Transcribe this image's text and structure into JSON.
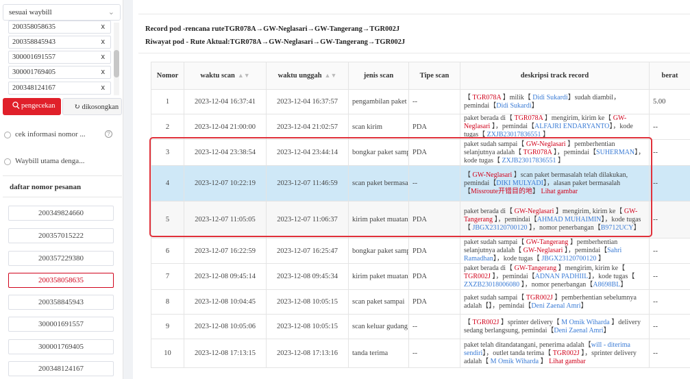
{
  "left": {
    "select_value": "sesuai waybill",
    "waybills": [
      "200358058635",
      "200358845943",
      "300001691557",
      "300001769405",
      "200348124167"
    ],
    "remove_glyph": "x",
    "search_label": "pengecekan",
    "clear_label": "dikosongkan",
    "options": [
      "cek informasi nomor ...",
      "Waybill utama denga..."
    ],
    "help_glyph": "?",
    "orders_title": "daftar nomor pesanan",
    "orders": [
      "200349824660",
      "200357015222",
      "200357229380",
      "200358058635",
      "200358845943",
      "300001691557",
      "300001769405",
      "200348124167"
    ],
    "active_order": "200358058635"
  },
  "route": {
    "plan": "Record pod -rencana ruteTGR078A→GW-Neglasari→GW-Tangerang→TGR002J",
    "actual": "Riwayat pod - Rute Aktual:TGR078A→GW-Neglasari→GW-Tangerang→TGR002J"
  },
  "table": {
    "headers": [
      "Nomor",
      "waktu scan",
      "waktu unggah",
      "jenis scan",
      "Tipe scan",
      "deskripsi track record",
      "berat"
    ],
    "rows": [
      {
        "no": "1",
        "scan": "2023-12-04 16:37:41",
        "upload": "2023-12-04 16:37:57",
        "type": "pengambilan paket",
        "tipe": "--",
        "weight": "5.00",
        "desc": [
          [
            "【",
            ""
          ],
          [
            " TGR078A ",
            "red"
          ],
          [
            "】milik【 ",
            ""
          ],
          [
            "Didi Sukardi",
            "blue"
          ],
          [
            "】sudah diambil，pemindai【",
            ""
          ],
          [
            "Didi Sukardi",
            "blue"
          ],
          [
            "】",
            ""
          ]
        ]
      },
      {
        "no": "2",
        "scan": "2023-12-04 21:00:00",
        "upload": "2023-12-04 21:02:57",
        "type": "scan kirim",
        "tipe": "PDA",
        "weight": "--",
        "desc": [
          [
            "paket berada di【 ",
            ""
          ],
          [
            "TGR078A",
            "red"
          ],
          [
            " 】mengirim, kirim ke【 ",
            ""
          ],
          [
            "GW-Neglasari",
            "red"
          ],
          [
            " 】，pemindai【",
            ""
          ],
          [
            "ALFAJRI ENDARYANTO",
            "blue"
          ],
          [
            "】，kode tugas【 ",
            ""
          ],
          [
            "ZXJB23017836551",
            "blue"
          ],
          [
            " 】",
            ""
          ]
        ]
      },
      {
        "no": "3",
        "scan": "2023-12-04 23:38:54",
        "upload": "2023-12-04 23:44:14",
        "type": "bongkar paket sampai",
        "tipe": "PDA",
        "weight": "--",
        "desc": [
          [
            "paket sudah sampai【 ",
            ""
          ],
          [
            "GW-Neglasari",
            "red"
          ],
          [
            " 】pemberhentian selanjutnya adalah【 ",
            ""
          ],
          [
            "TGR078A",
            "red"
          ],
          [
            " 】，pemindai【",
            ""
          ],
          [
            "SUHERMAN",
            "blue"
          ],
          [
            "】，kode tugas【 ",
            ""
          ],
          [
            "ZXJB23017836551",
            "blue"
          ],
          [
            " 】",
            ""
          ]
        ]
      },
      {
        "no": "4",
        "scan": "2023-12-07 10:22:19",
        "upload": "2023-12-07 11:46:59",
        "type": "scan paket bermasalah",
        "tipe": "--",
        "weight": "--",
        "desc": [
          [
            "【 ",
            ""
          ],
          [
            "GW-Neglasari",
            "red"
          ],
          [
            " 】scan paket bermasalah telah dilakukan, pemindai【",
            ""
          ],
          [
            "DIKI MULYADI",
            "blue"
          ],
          [
            "】，alasan paket bermasalah【",
            ""
          ],
          [
            "Missroute开错目的地",
            "red"
          ],
          [
            "】  ",
            ""
          ],
          [
            "Lihat gambar",
            "red"
          ]
        ]
      },
      {
        "no": "5",
        "scan": "2023-12-07 11:05:05",
        "upload": "2023-12-07 11:06:37",
        "type": "kirim paket muatan",
        "tipe": "PDA",
        "weight": "--",
        "desc": [
          [
            "paket berada di【 ",
            ""
          ],
          [
            "GW-Neglasari",
            "red"
          ],
          [
            " 】mengirim, kirim ke【 ",
            ""
          ],
          [
            "GW-Tangerang",
            "red"
          ],
          [
            " 】，pemindai【",
            ""
          ],
          [
            "AHMAD MUHAIMIN",
            "blue"
          ],
          [
            "】，kode tugas【 ",
            ""
          ],
          [
            "JBGX23120700120",
            "blue"
          ],
          [
            " 】，nomor penerbangan【",
            ""
          ],
          [
            "B9712UCY",
            "blue"
          ],
          [
            "】",
            ""
          ]
        ]
      },
      {
        "no": "6",
        "scan": "2023-12-07 16:22:59",
        "upload": "2023-12-07 16:25:47",
        "type": "bongkar paket sampai",
        "tipe": "PDA",
        "weight": "--",
        "desc": [
          [
            "paket sudah sampai【 ",
            ""
          ],
          [
            "GW-Tangerang",
            "red"
          ],
          [
            " 】pemberhentian selanjutnya adalah【 ",
            ""
          ],
          [
            "GW-Neglasari",
            "red"
          ],
          [
            " 】，pemindai【",
            ""
          ],
          [
            "Sahri Ramadhan",
            "blue"
          ],
          [
            "】，kode tugas【 ",
            ""
          ],
          [
            "JBGX23120700120",
            "blue"
          ],
          [
            " 】",
            ""
          ]
        ]
      },
      {
        "no": "7",
        "scan": "2023-12-08 09:45:14",
        "upload": "2023-12-08 09:45:34",
        "type": "kirim paket muatan",
        "tipe": "PDA",
        "weight": "--",
        "desc": [
          [
            "paket berada di【 ",
            ""
          ],
          [
            "GW-Tangerang",
            "red"
          ],
          [
            " 】mengirim, kirim ke【 ",
            ""
          ],
          [
            "TGR002J",
            "red"
          ],
          [
            " 】，pemindai【",
            ""
          ],
          [
            "ADNAN PADHIIL",
            "blue"
          ],
          [
            "】，kode tugas【 ",
            ""
          ],
          [
            "ZXZB23018006080",
            "blue"
          ],
          [
            " 】，nomor penerbangan【",
            ""
          ],
          [
            "A8698BL",
            "blue"
          ],
          [
            "】",
            ""
          ]
        ]
      },
      {
        "no": "8",
        "scan": "2023-12-08 10:04:45",
        "upload": "2023-12-08 10:05:15",
        "type": "scan paket sampai",
        "tipe": "PDA",
        "weight": "--",
        "desc": [
          [
            "paket sudah sampai【 ",
            ""
          ],
          [
            "TGR002J",
            "red"
          ],
          [
            " 】pemberhentian sebelumnya adalah【",
            ""
          ],
          [
            "",
            ""
          ],
          [
            "】，pemindai【",
            ""
          ],
          [
            "Deni Zaenal Amri",
            "blue"
          ],
          [
            "】",
            ""
          ]
        ]
      },
      {
        "no": "9",
        "scan": "2023-12-08 10:05:06",
        "upload": "2023-12-08 10:05:15",
        "type": "scan keluar gudang",
        "tipe": "--",
        "weight": "--",
        "desc": [
          [
            "【 ",
            ""
          ],
          [
            "TGR002J",
            "red"
          ],
          [
            " 】sprinter delivery【 ",
            ""
          ],
          [
            "M Omik Wiharda",
            "blue"
          ],
          [
            " 】delivery sedang berlangsung, pemindai【",
            ""
          ],
          [
            "Deni Zaenal Amri",
            "blue"
          ],
          [
            "】",
            ""
          ]
        ]
      },
      {
        "no": "10",
        "scan": "2023-12-08 17:13:15",
        "upload": "2023-12-08 17:13:16",
        "type": "tanda terima",
        "tipe": "--",
        "weight": "--",
        "desc": [
          [
            "paket telah ditandatangani, penerima adalah【",
            ""
          ],
          [
            "will - diterima sendiri",
            "blue"
          ],
          [
            "】，outlet tanda terima【 ",
            ""
          ],
          [
            "TGR002J",
            "red"
          ],
          [
            " 】，sprinter delivery adalah【 ",
            ""
          ],
          [
            "M Omik Wiharda",
            "blue"
          ],
          [
            " 】  ",
            ""
          ],
          [
            "Lihat gambar",
            "red"
          ]
        ]
      }
    ]
  },
  "colors": {
    "accent": "#e0202a",
    "highlight_row": "#cfe8f7",
    "link_blue": "#3a7bd5",
    "warn_red": "#d0021b"
  }
}
